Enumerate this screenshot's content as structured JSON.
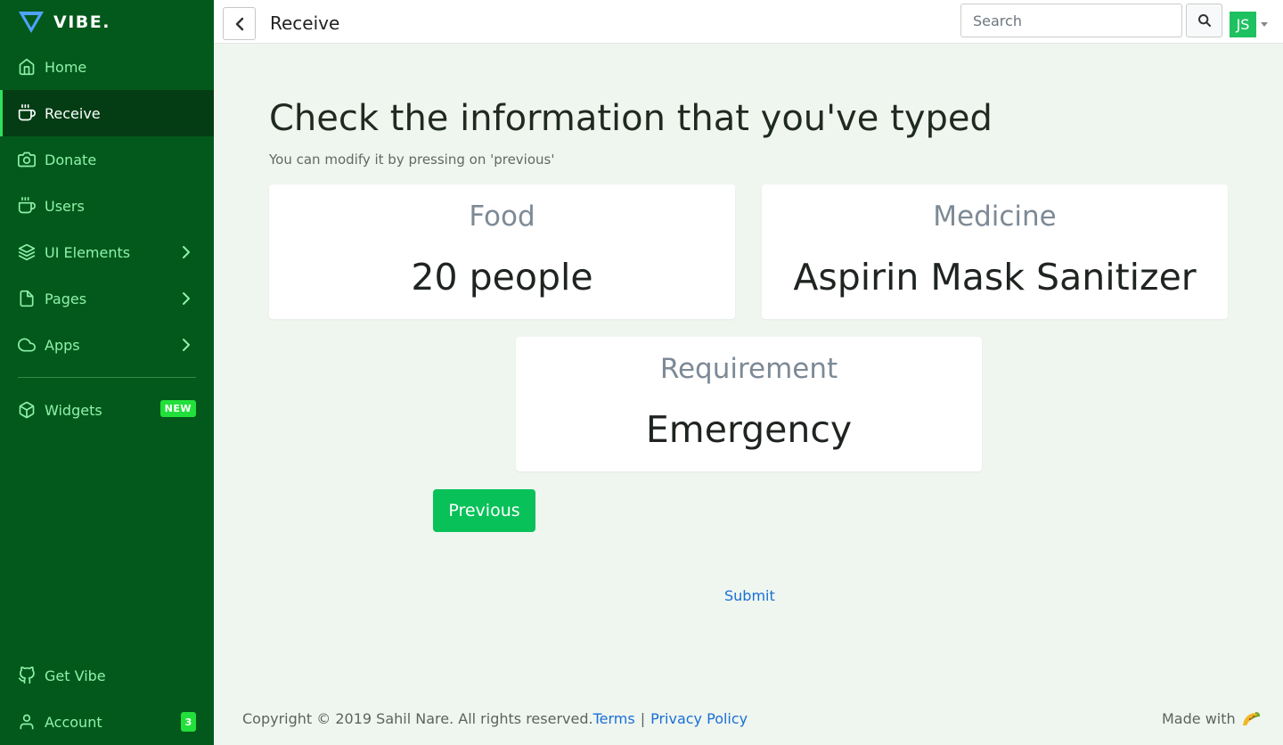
{
  "brand": {
    "name": "VIBE."
  },
  "sidebar": {
    "items": [
      {
        "label": "Home",
        "icon": "home-icon"
      },
      {
        "label": "Receive",
        "icon": "coffee-icon",
        "active": true
      },
      {
        "label": "Donate",
        "icon": "camera-icon"
      },
      {
        "label": "Users",
        "icon": "coffee-icon"
      },
      {
        "label": "UI Elements",
        "icon": "layers-icon"
      },
      {
        "label": "Pages",
        "icon": "file-icon"
      },
      {
        "label": "Apps",
        "icon": "cloud-icon"
      },
      {
        "label": "Widgets",
        "icon": "box-icon",
        "badge": "NEW"
      },
      {
        "label": "Get Vibe",
        "icon": "github-icon"
      },
      {
        "label": "Account",
        "icon": "user-icon",
        "badge": "3"
      }
    ]
  },
  "topbar": {
    "title": "Receive",
    "search_placeholder": "Search",
    "avatar_initials": "JS"
  },
  "main": {
    "heading": "Check the information that you've typed",
    "subheading": "You can modify it by pressing on 'previous'",
    "cards": [
      {
        "label": "Food",
        "value": "20 people"
      },
      {
        "label": "Medicine",
        "value": "Aspirin Mask Sanitizer"
      },
      {
        "label": "Requirement",
        "value": "Emergency"
      }
    ],
    "previous_label": "Previous",
    "submit_label": "Submit"
  },
  "footer": {
    "copyright": "Copyright © 2019 Sahil Nare. All rights reserved.",
    "terms": "Terms",
    "separator": "|",
    "privacy": "Privacy Policy",
    "made_with": "Made with"
  },
  "colors": {
    "sidebar_bg": "#03591b",
    "sidebar_active_bg": "#043d14",
    "sidebar_text": "#8ef2a9",
    "accent": "#22e03b",
    "button": "#08c159",
    "link": "#1a6fd6",
    "page_bg": "#eff6ef"
  }
}
